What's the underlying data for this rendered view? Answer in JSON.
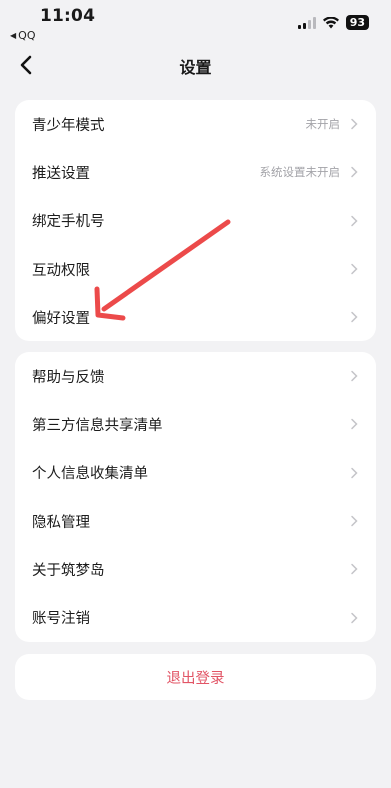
{
  "status_bar": {
    "time": "11:04",
    "back_app": "QQ",
    "battery": "93"
  },
  "nav": {
    "title": "设置"
  },
  "group1": [
    {
      "label": "青少年模式",
      "value": "未开启"
    },
    {
      "label": "推送设置",
      "value": "系统设置未开启"
    },
    {
      "label": "绑定手机号",
      "value": ""
    },
    {
      "label": "互动权限",
      "value": ""
    },
    {
      "label": "偏好设置",
      "value": ""
    }
  ],
  "group2": [
    {
      "label": "帮助与反馈"
    },
    {
      "label": "第三方信息共享清单"
    },
    {
      "label": "个人信息收集清单"
    },
    {
      "label": "隐私管理"
    },
    {
      "label": "关于筑梦岛"
    },
    {
      "label": "账号注销"
    }
  ],
  "logout": {
    "label": "退出登录"
  },
  "colors": {
    "accent_red": "#e25566",
    "annotation_arrow": "#ec4a4a"
  }
}
